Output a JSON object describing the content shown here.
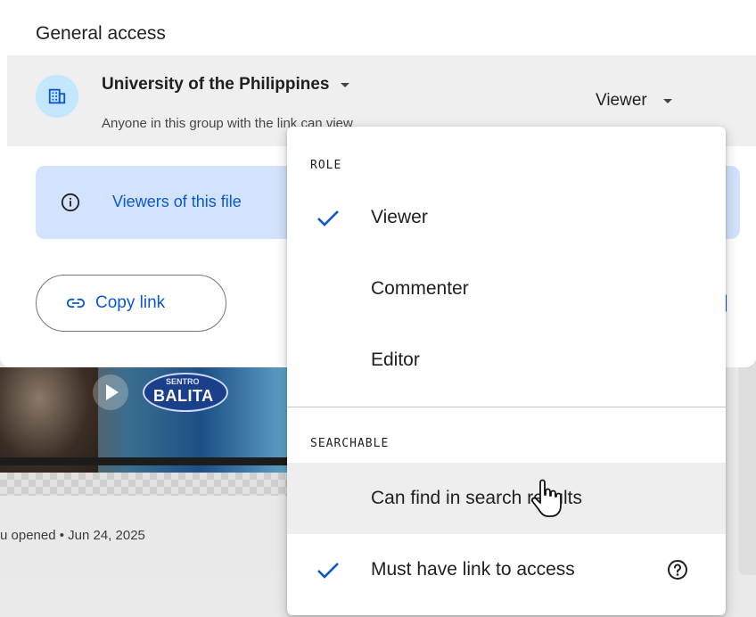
{
  "dialog": {
    "heading": "General access",
    "access": {
      "org_name": "University of the Philippines",
      "description": "Anyone in this group with the link can view",
      "role": "Viewer"
    },
    "info_banner": {
      "text": "Viewers of this file"
    },
    "copy_link": {
      "label": "Copy link"
    }
  },
  "menu": {
    "role_section": "ROLE",
    "roles": [
      {
        "label": "Viewer",
        "selected": true
      },
      {
        "label": "Commenter",
        "selected": false
      },
      {
        "label": "Editor",
        "selected": false
      }
    ],
    "searchable_section": "SEARCHABLE",
    "searchable": [
      {
        "label": "Can find in search results",
        "selected": false,
        "hovered": true
      },
      {
        "label": "Must have link to access",
        "selected": true
      }
    ]
  },
  "background": {
    "thumbnail_logo_top": "SENTRO",
    "thumbnail_logo_main": "BALITA",
    "opened_text": "u opened • Jun 24, 2025"
  },
  "colors": {
    "accent": "#0b57d0",
    "banner_bg": "#d3e3fd",
    "org_icon_bg": "#c2e7ff"
  }
}
